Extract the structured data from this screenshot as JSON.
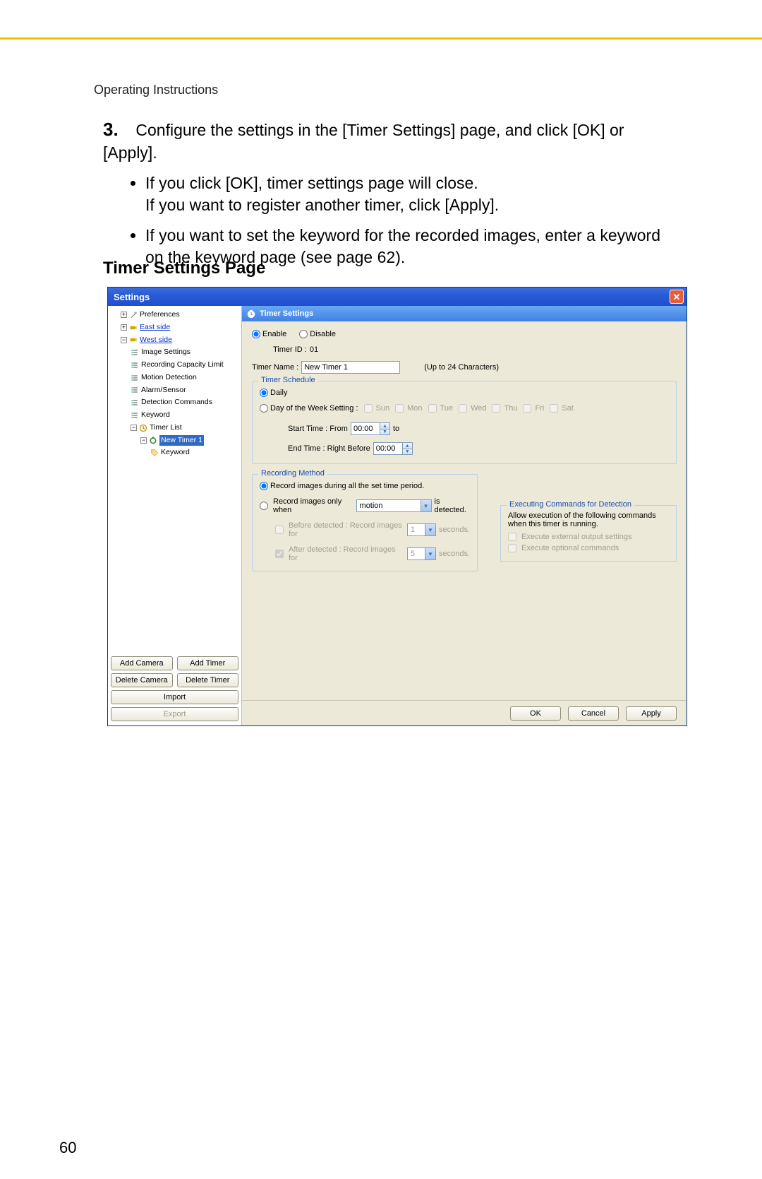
{
  "doc": {
    "header": "Operating Instructions",
    "step_number": "3.",
    "step_text": "Configure the settings in the [Timer Settings] page, and click [OK] or [Apply].",
    "bullet1a": "If you click [OK], timer settings page will close.",
    "bullet1b": "If you want to register another timer, click [Apply].",
    "bullet2": "If you want to set the keyword for the recorded images, enter a keyword on the keyword page (see page 62).",
    "section_title": "Timer Settings Page",
    "page_number": "60"
  },
  "window": {
    "title": "Settings",
    "close": "✕",
    "tree": {
      "preferences": "Preferences",
      "east_side": "East side",
      "west_side": "West side",
      "image_settings": "Image Settings",
      "recording_capacity": "Recording Capacity Limit",
      "motion_detection": "Motion Detection",
      "alarm_sensor": "Alarm/Sensor",
      "detection_commands": "Detection Commands",
      "keyword": "Keyword",
      "timer_list": "Timer List",
      "new_timer": "New Timer 1",
      "keyword2": "Keyword"
    },
    "left_buttons": {
      "add_camera": "Add Camera",
      "add_timer": "Add Timer",
      "delete_camera": "Delete Camera",
      "delete_timer": "Delete Timer",
      "import": "Import",
      "export": "Export"
    },
    "panel_title": "Timer Settings",
    "enable": "Enable",
    "disable": "Disable",
    "timer_id_label": "Timer ID :",
    "timer_id_value": "01",
    "timer_name_label": "Timer Name :",
    "timer_name_value": "New Timer 1",
    "timer_name_hint": "(Up to 24 Characters)",
    "schedule_legend": "Timer Schedule",
    "daily": "Daily",
    "dow_label": "Day of the Week Setting :",
    "days": {
      "sun": "Sun",
      "mon": "Mon",
      "tue": "Tue",
      "wed": "Wed",
      "thu": "Thu",
      "fri": "Fri",
      "sat": "Sat"
    },
    "start_time_label": "Start Time :   From",
    "start_time_value": "00:00",
    "to": "to",
    "end_time_label": "End Time :   Right Before",
    "end_time_value": "00:00",
    "method_legend": "Recording Method",
    "method_all": "Record images during all the set time period.",
    "method_only_prefix": "Record images only when",
    "method_only_value": "motion",
    "method_only_suffix": "is detected.",
    "before_label": "Before detected :   Record images for",
    "before_value": "1",
    "seconds": "seconds.",
    "after_check": "After    detected :   Record images for",
    "after_value": "5",
    "cmds_legend": "Executing Commands for Detection",
    "cmds_note": "Allow execution of the following commands when this timer is running.",
    "cmd1": "Execute external output settings",
    "cmd2": "Execute optional commands",
    "ok": "OK",
    "cancel": "Cancel",
    "apply": "Apply"
  }
}
